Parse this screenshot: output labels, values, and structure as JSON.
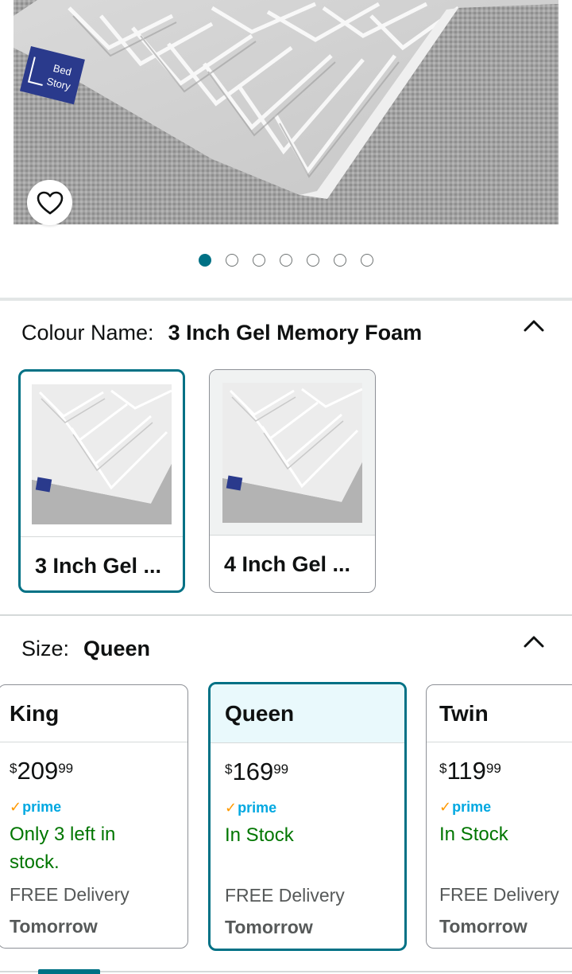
{
  "product_image": {
    "brand_label": "Bed Story"
  },
  "wishlist": {
    "icon": "heart-icon"
  },
  "carousel": {
    "count": 7,
    "active_index": 0
  },
  "colour": {
    "label": "Colour Name:",
    "value": "3 Inch Gel Memory Foam",
    "options": [
      {
        "name": "3 Inch Gel ...",
        "selected": true
      },
      {
        "name": "4 Inch Gel ...",
        "selected": false
      }
    ]
  },
  "size": {
    "label": "Size:",
    "value": "Queen",
    "options": [
      {
        "name": "King",
        "currency": "$",
        "whole": "209",
        "fraction": "99",
        "prime": "prime",
        "stock": "Only 3 left in stock.",
        "delivery": "FREE Delivery",
        "delivery_day": "Tomorrow",
        "selected": false
      },
      {
        "name": "Queen",
        "currency": "$",
        "whole": "169",
        "fraction": "99",
        "prime": "prime",
        "stock": "In Stock",
        "delivery": "FREE Delivery",
        "delivery_day": "Tomorrow",
        "selected": true
      },
      {
        "name": "Twin",
        "currency": "$",
        "whole": "119",
        "fraction": "99",
        "prime": "prime",
        "stock": "In Stock",
        "delivery": "FREE Delivery",
        "delivery_day": "Tomorrow",
        "selected": false
      }
    ]
  },
  "colors": {
    "accent": "#007185",
    "stock_green": "#007600",
    "prime_blue": "#00a8e1"
  }
}
